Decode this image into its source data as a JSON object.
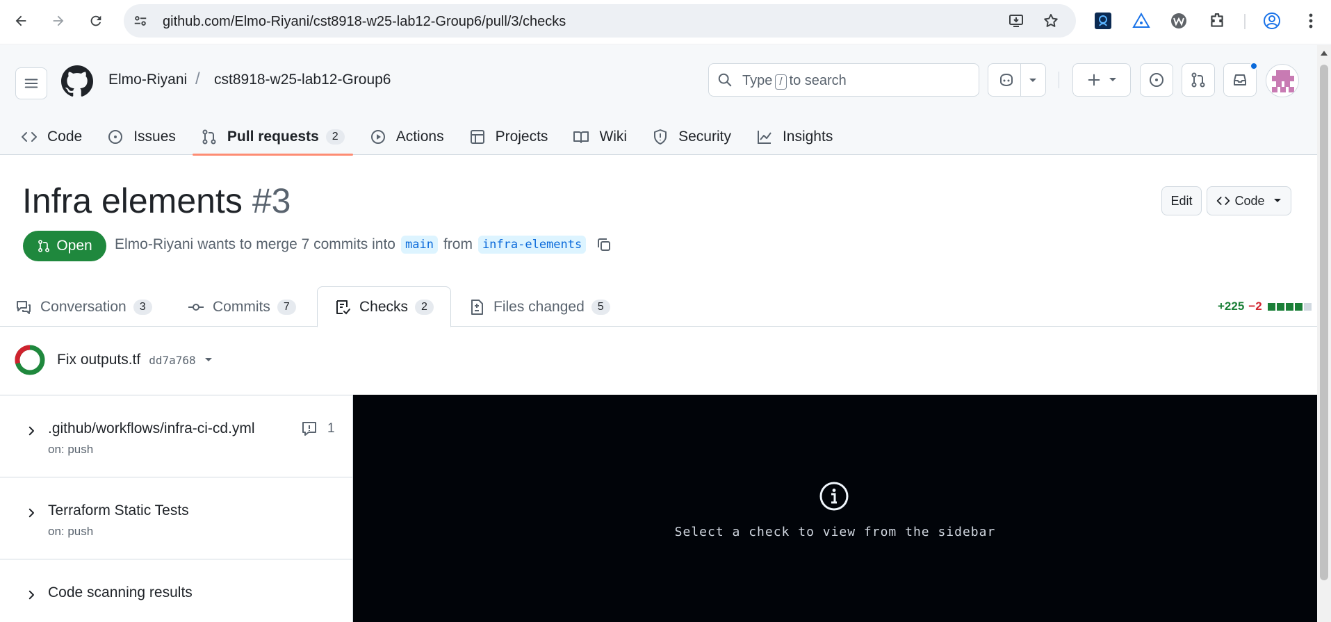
{
  "browser": {
    "url": "github.com/Elmo-Riyani/cst8918-w25-lab12-Group6/pull/3/checks"
  },
  "header": {
    "owner": "Elmo-Riyani",
    "separator": "/",
    "repo": "cst8918-w25-lab12-Group6",
    "search_prefix": "Type",
    "search_key": "/",
    "search_suffix": "to search"
  },
  "repo_tabs": [
    {
      "label": "Code",
      "icon": "code-icon"
    },
    {
      "label": "Issues",
      "icon": "issue-icon"
    },
    {
      "label": "Pull requests",
      "icon": "pull-request-icon",
      "count": "2",
      "active": true
    },
    {
      "label": "Actions",
      "icon": "play-icon"
    },
    {
      "label": "Projects",
      "icon": "table-icon"
    },
    {
      "label": "Wiki",
      "icon": "book-icon"
    },
    {
      "label": "Security",
      "icon": "shield-icon"
    },
    {
      "label": "Insights",
      "icon": "graph-icon"
    }
  ],
  "pr": {
    "title": "Infra elements",
    "number": "#3",
    "edit_label": "Edit",
    "code_label": "Code",
    "state": "Open",
    "author": "Elmo-Riyani",
    "merge_text": "wants to merge 7 commits into",
    "base_branch": "main",
    "from_text": "from",
    "head_branch": "infra-elements"
  },
  "pr_tabs": [
    {
      "label": "Conversation",
      "count": "3"
    },
    {
      "label": "Commits",
      "count": "7"
    },
    {
      "label": "Checks",
      "count": "2",
      "active": true
    },
    {
      "label": "Files changed",
      "count": "5"
    }
  ],
  "diffstat": {
    "additions": "+225",
    "deletions": "−2",
    "blocks_added": 4,
    "blocks_total": 5
  },
  "commit": {
    "message": "Fix outputs.tf",
    "sha": "dd7a768"
  },
  "workflows": [
    {
      "name": ".github/workflows/infra-ci-cd.yml",
      "trigger": "on: push",
      "annotations": "1"
    },
    {
      "name": "Terraform Static Tests",
      "trigger": "on: push"
    },
    {
      "name": "Code scanning results"
    }
  ],
  "log_panel": {
    "message": "Select a check to view from the sidebar"
  },
  "colors": {
    "open_green": "#1f883d",
    "active_tab_underline": "#fd8c73",
    "link_blue": "#0969da",
    "log_bg": "#010409"
  }
}
